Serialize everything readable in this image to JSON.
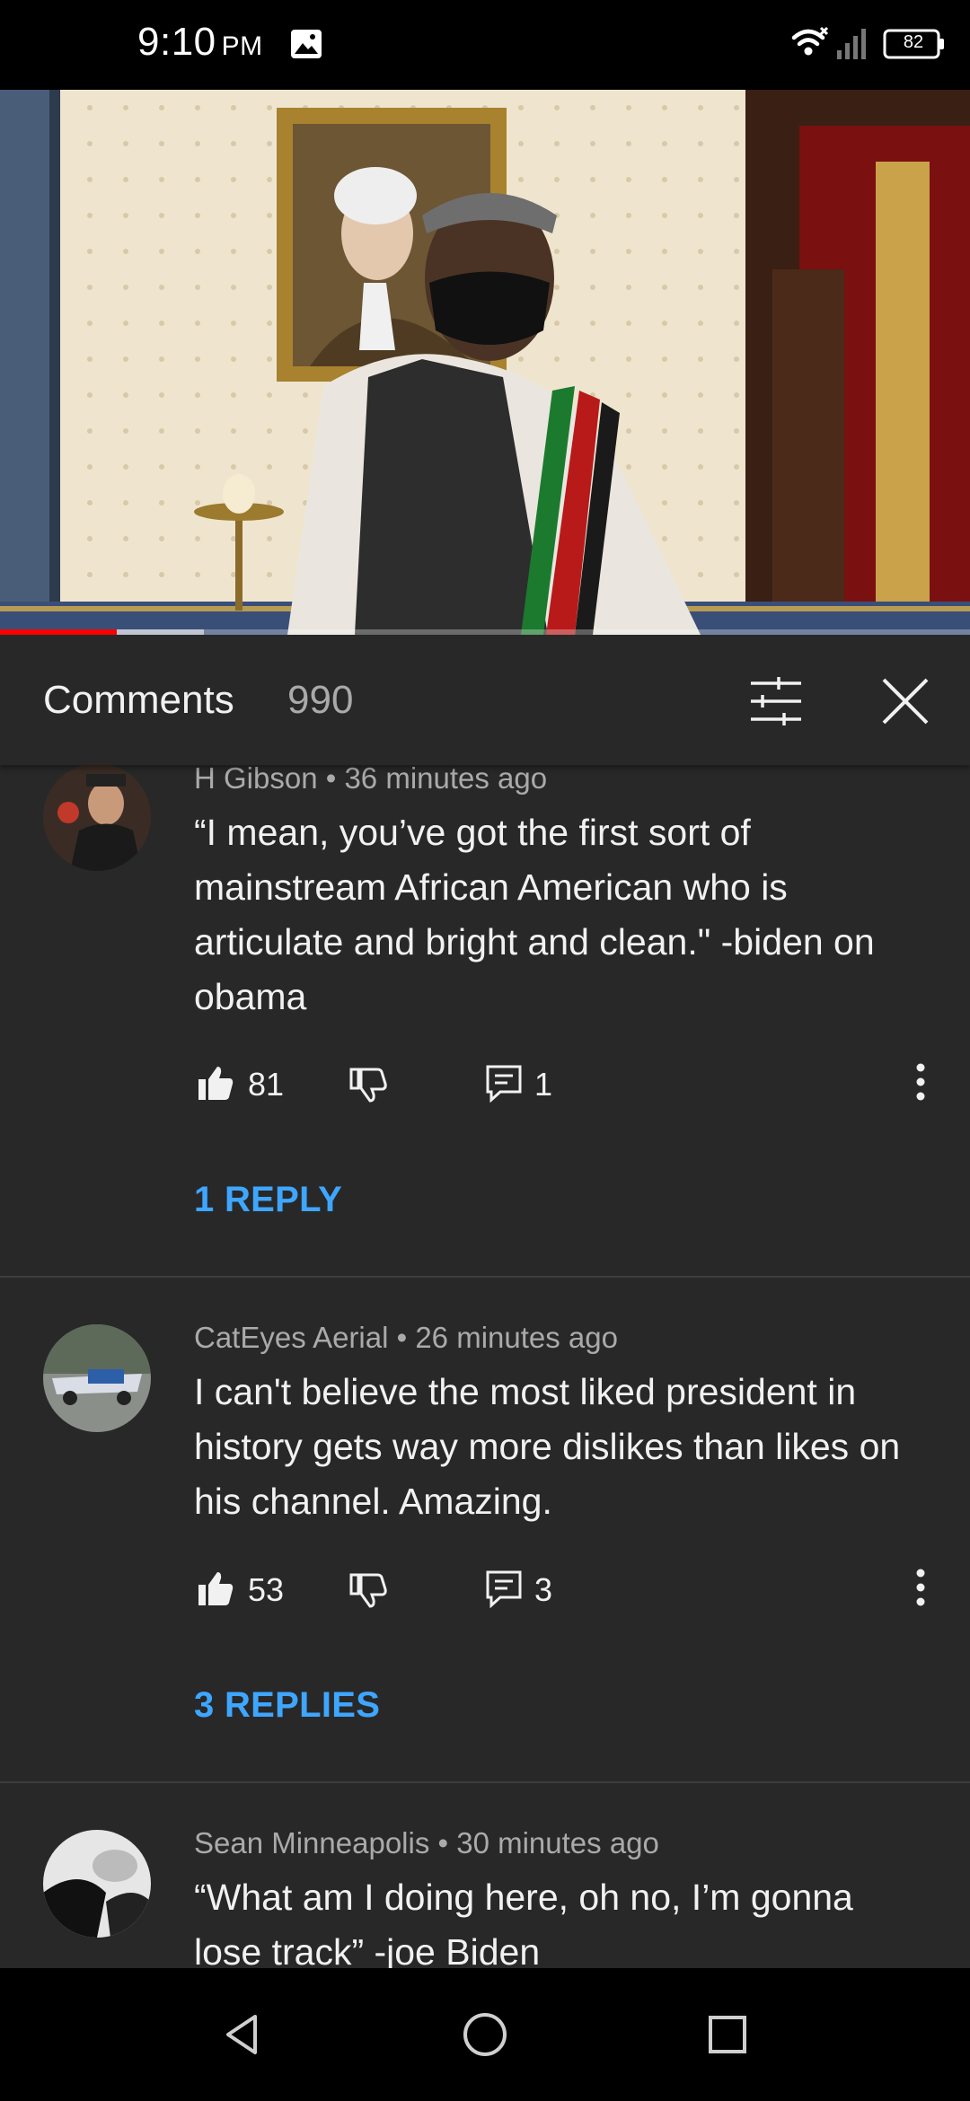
{
  "status_bar": {
    "time": "9:10",
    "ampm": "PM",
    "battery": "82",
    "icons": [
      "gallery-icon",
      "wifi-icon",
      "signal-icon",
      "battery-icon"
    ]
  },
  "video": {
    "progress_played": 0.12,
    "progress_buffered": 0.21,
    "accent_color": "#ff0000"
  },
  "comments_panel": {
    "title": "Comments",
    "count": "990"
  },
  "comments": [
    {
      "author": "H Gibson",
      "time": "36 minutes ago",
      "text": "“I mean, you’ve got the first sort of mainstream African American who is articulate and bright and clean.\" -biden on obama",
      "likes": "81",
      "reply_count": "1",
      "replies_label": "1 REPLY"
    },
    {
      "author": "CatEyes Aerial",
      "time": "26 minutes ago",
      "text": "I can't believe the most liked president in history gets way more dislikes than likes on his channel. Amazing.",
      "likes": "53",
      "reply_count": "3",
      "replies_label": "3 REPLIES"
    },
    {
      "author": "Sean Minneapolis",
      "time": "30 minutes ago",
      "text": "“What am I doing here, oh no, I’m gonna lose track” -joe Biden",
      "likes": "",
      "reply_count": "",
      "replies_label": ""
    }
  ],
  "colors": {
    "background": "#282828",
    "link": "#3ea6ff",
    "secondary_text": "#aaaaaa"
  }
}
